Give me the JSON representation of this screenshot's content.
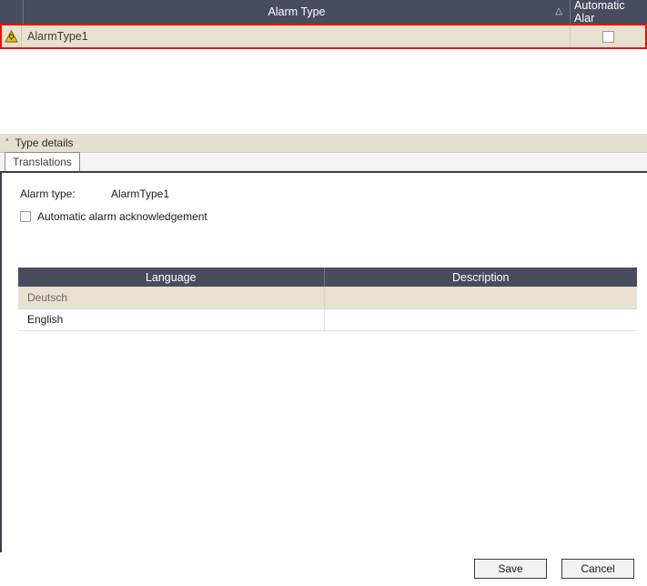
{
  "grid": {
    "columns": [
      {
        "key": "indicator",
        "label": ""
      },
      {
        "key": "alarm_type",
        "label": "Alarm Type",
        "sort_indicator": "△"
      },
      {
        "key": "automatic_alarm",
        "label": "Automatic Alar"
      }
    ],
    "rows": [
      {
        "indicator_icon": "warning-triangle-icon",
        "alarm_type": "AlarmType1",
        "automatic_alarm_checked": false,
        "selected": true,
        "validation_error": true
      }
    ],
    "highlight_color": "#e51400",
    "header_color": "#474c5e",
    "selected_row_color": "#e8e0d0"
  },
  "type_details": {
    "title": "Type details",
    "collapse_icon": "chevron-up-icon",
    "collapse_glyph": "˄",
    "tabs": [
      {
        "label": "Translations",
        "active": true
      }
    ],
    "fields": {
      "alarm_type_label": "Alarm type:",
      "alarm_type_value": "AlarmType1"
    },
    "checkbox": {
      "label": "Automatic alarm acknowledgement",
      "checked": false
    },
    "translations_table": {
      "columns": [
        "Language",
        "Description"
      ],
      "rows": [
        {
          "language": "Deutsch",
          "description": "",
          "selected": true
        },
        {
          "language": "English",
          "description": "",
          "selected": false
        }
      ]
    },
    "buttons": {
      "save_label": "Save",
      "cancel_label": "Cancel"
    }
  }
}
